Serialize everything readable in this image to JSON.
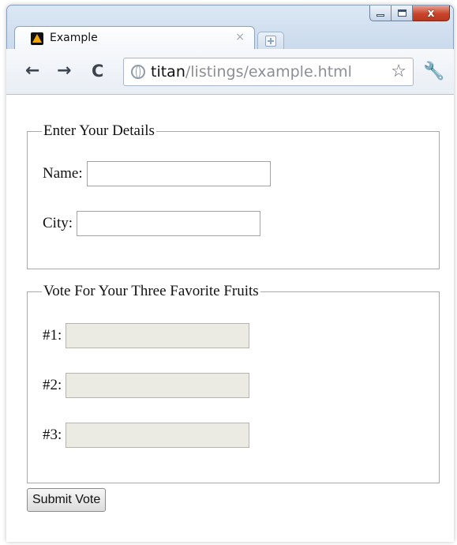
{
  "browser": {
    "tab_title": "Example",
    "tab_close_glyph": "×",
    "url_host": "titan",
    "url_path": "/listings/example.html",
    "icons": [
      "back-icon",
      "forward-icon",
      "reload-icon",
      "globe-icon",
      "star-icon",
      "wrench-icon",
      "new-tab-icon",
      "app-favicon-icon"
    ],
    "nav": {
      "back": "←",
      "forward": "→",
      "reload": "C",
      "star": "☆",
      "wrench": "🔧"
    },
    "caption": {
      "close": "x"
    }
  },
  "form": {
    "details_legend": "Enter Your Details",
    "name_label": "Name:",
    "name_value": "",
    "city_label": "City:",
    "city_value": "",
    "fruits_legend": "Vote For Your Three Favorite Fruits",
    "fruit1_label": "#1:",
    "fruit2_label": "#2:",
    "fruit3_label": "#3:",
    "fruit1_value": "",
    "fruit2_value": "",
    "fruit3_value": "",
    "submit_label": "Submit Vote"
  },
  "colors": {
    "window_frame": "#c9d9ec",
    "close_button": "#c9442a",
    "disabled_input": "#ebebe4"
  }
}
